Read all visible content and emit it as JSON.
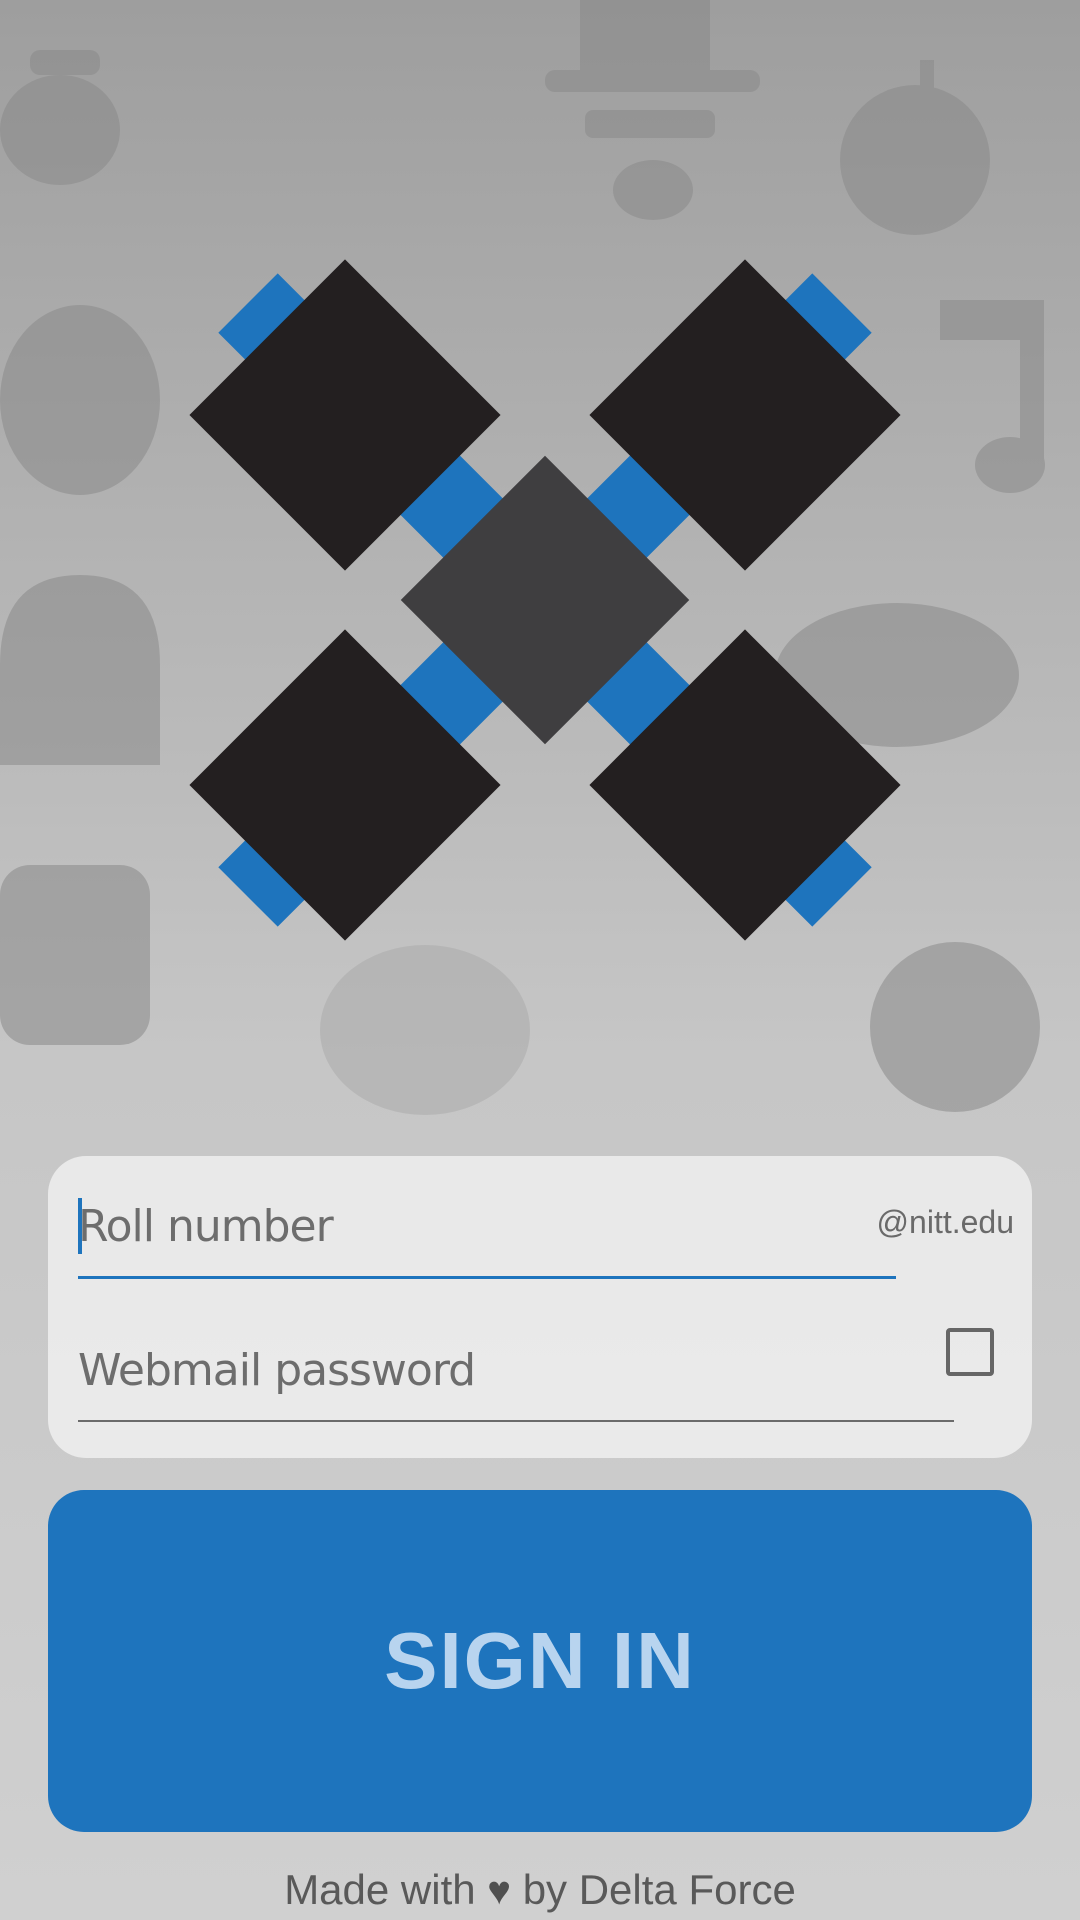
{
  "login": {
    "roll_placeholder": "Roll number",
    "roll_value": "",
    "domain_suffix": "@nitt.edu",
    "password_placeholder": "Webmail password",
    "password_value": "",
    "show_password_checked": false
  },
  "signin_button": {
    "label": "SIGN IN"
  },
  "footer": {
    "prefix": "Made with",
    "heart_icon": "heart-icon",
    "suffix": "by Delta Force"
  },
  "colors": {
    "accent": "#1e74bd",
    "tile": "#231f20",
    "center_tile": "#3f3e40"
  },
  "background_icons": [
    "skull-icon",
    "hat-icon",
    "bomb-icon",
    "music-note-icon",
    "helmet-icon",
    "bat-symbol-icon",
    "camera-icon",
    "trollface-icon",
    "pokeball-icon"
  ]
}
